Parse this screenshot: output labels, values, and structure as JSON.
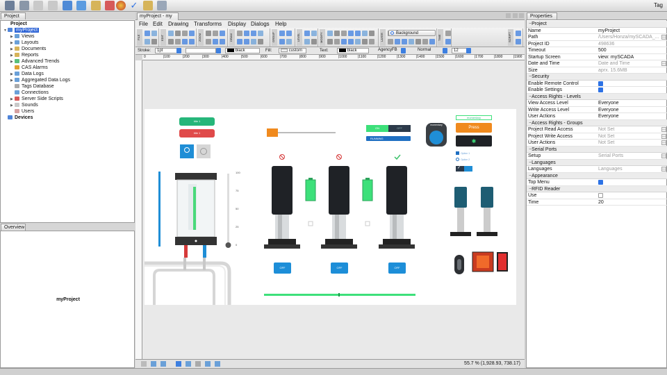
{
  "app": {
    "tag_label": "Tag"
  },
  "project_panel": {
    "tab": "Project",
    "root": "Project",
    "project_name": "myProject",
    "items": [
      "Views",
      "Layouts",
      "Documents",
      "Reports",
      "Advanced Trends",
      "CAS Alarms",
      "Data Logs",
      "Aggregated Data Logs",
      "Tags Database",
      "Connections",
      "Server Side Scripts",
      "Sounds",
      "Users"
    ],
    "devices": "Devices"
  },
  "overview_panel": {
    "tab": "Overview",
    "project_name": "myProject"
  },
  "editor": {
    "tab": "myProject - my",
    "menu": [
      "File",
      "Edit",
      "Drawing",
      "Transforms",
      "Display",
      "Dialogs",
      "Help"
    ],
    "ribbon_groups": [
      "FILE",
      "EDIT",
      "ZOOM",
      "DRAW",
      "GROUP",
      "LEVEL",
      "MODIFY",
      "LAYER",
      "TIME",
      "SCRIPT"
    ],
    "background_button": "Background",
    "stylebar": {
      "stroke_label": "Stroke:",
      "stroke_width": "1pt",
      "stroke_color": "black",
      "fill_label": "Fill:",
      "fill_value": "custom",
      "text_label": "Text:",
      "text_color": "black",
      "font": "AgencyFB",
      "font_style": "Normal",
      "font_size": "12"
    },
    "ruler_ticks": [
      "0",
      "|100",
      "|200",
      "|300",
      "|400",
      "|500",
      "|600",
      "|700",
      "|800",
      "|900",
      "|1000",
      "|1100",
      "|1200",
      "|1300",
      "|1400",
      "|1500",
      "|1600",
      "|1700",
      "|1800",
      "|1900"
    ],
    "status": "55.7 % (1,928.93, 738.17)",
    "hmi": {
      "btn_green": "title 1",
      "btn_red": "title 1",
      "toggle_on": "ON",
      "toggle_off": "OFF",
      "running": "RUNNING",
      "momentary": "momentary",
      "momentary_top": "momentary",
      "press": "Press",
      "option1": "Option 1",
      "option2": "Option 2",
      "pump_off": "OFF",
      "tank_scale": [
        "100",
        "75",
        "50",
        "25",
        "0"
      ]
    }
  },
  "properties": {
    "tab": "Properties",
    "rows": [
      {
        "type": "section",
        "label": "Project"
      },
      {
        "type": "text",
        "key": "Name",
        "value": "myProject"
      },
      {
        "type": "text",
        "key": "Path",
        "value": "/Users/Honza/mySCADA_...",
        "gray": true,
        "dots": true
      },
      {
        "type": "text",
        "key": "Project ID",
        "value": "498636",
        "gray": true
      },
      {
        "type": "text",
        "key": "Timeout",
        "value": "500"
      },
      {
        "type": "text",
        "key": "Startup Screen",
        "value": "view: mySCADA"
      },
      {
        "type": "text",
        "key": "Date and Time",
        "value": "Date and Time",
        "gray": true,
        "dots": true
      },
      {
        "type": "text",
        "key": "Size",
        "value": "aprx. 15.6MB",
        "gray": true
      },
      {
        "type": "section",
        "label": "Security"
      },
      {
        "type": "check",
        "key": "Enable Remote Control",
        "checked": true
      },
      {
        "type": "check",
        "key": "Enable Settings",
        "checked": true
      },
      {
        "type": "section",
        "label": "Access Rights - Levels"
      },
      {
        "type": "text",
        "key": "View Access Level",
        "value": "Everyone"
      },
      {
        "type": "text",
        "key": "Write Access Level",
        "value": "Everyone"
      },
      {
        "type": "text",
        "key": "User Actions",
        "value": "Everyone"
      },
      {
        "type": "section",
        "label": "Access Rights - Groups"
      },
      {
        "type": "text",
        "key": "Project Read Access",
        "value": "Not Set",
        "gray": true,
        "dots": true
      },
      {
        "type": "text",
        "key": "Project Write Access",
        "value": "Not Set",
        "gray": true,
        "dots": true
      },
      {
        "type": "text",
        "key": "User Actions",
        "value": "Not Set",
        "gray": true,
        "dots": true
      },
      {
        "type": "section",
        "label": "Serial Ports"
      },
      {
        "type": "text",
        "key": "Setup",
        "value": "Serial Ports",
        "gray": true,
        "dots": true
      },
      {
        "type": "section",
        "label": "Languages"
      },
      {
        "type": "text",
        "key": "Languages",
        "value": "Languages",
        "gray": true,
        "dots": true
      },
      {
        "type": "section",
        "label": "Appearance"
      },
      {
        "type": "check",
        "key": "Top Menu",
        "checked": true
      },
      {
        "type": "section",
        "label": "RFID Reader"
      },
      {
        "type": "check",
        "key": "Use",
        "checked": false
      },
      {
        "type": "text",
        "key": "Time",
        "value": "20"
      }
    ]
  }
}
